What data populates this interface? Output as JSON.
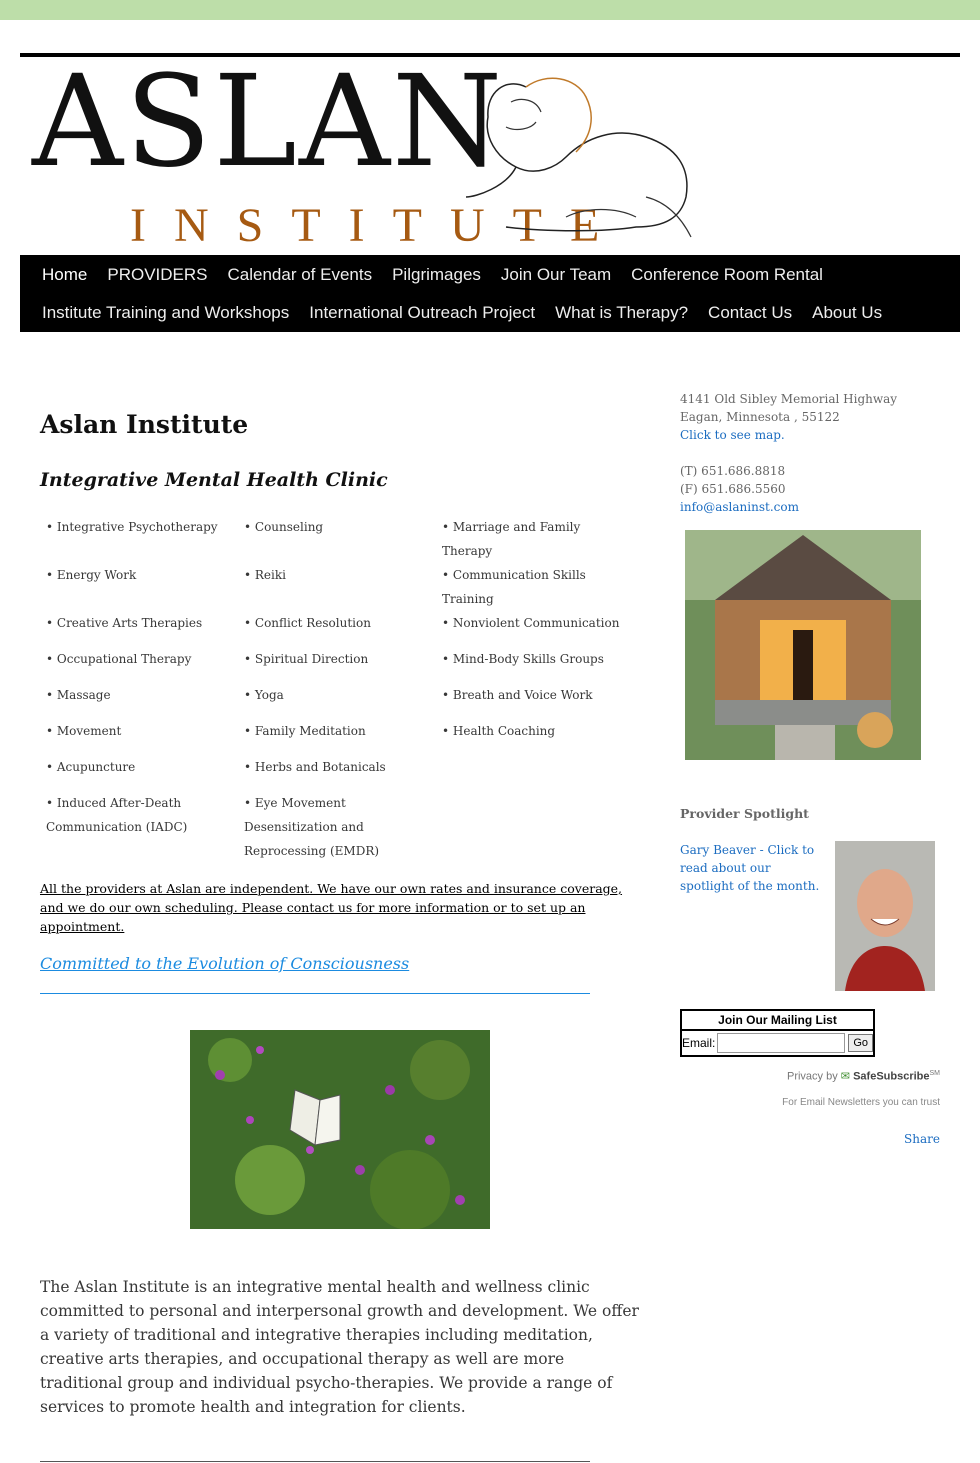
{
  "logo": {
    "aslan": "ASLAN",
    "institute": "INSTITUTE"
  },
  "nav": {
    "row1": [
      "Home",
      "PROVIDERS",
      "Calendar of Events",
      "Pilgrimages",
      "Join Our Team",
      "Conference Room Rental"
    ],
    "row2": [
      "Institute Training and Workshops",
      "International Outreach Project",
      "What is Therapy?",
      "Contact Us",
      "About Us"
    ]
  },
  "main": {
    "title": "Aslan Institute",
    "subtitle": "Integrative Mental Health Clinic",
    "services": [
      "• Integrative Psychotherapy",
      "• Counseling",
      "• Marriage and Family Therapy",
      "• Energy Work",
      "• Reiki",
      "• Communication Skills Training",
      "• Creative Arts Therapies",
      "• Conflict Resolution",
      "• Nonviolent Communication",
      "• Occupational Therapy",
      "• Spiritual Direction",
      "• Mind-Body Skills Groups",
      "• Massage",
      "• Yoga",
      "• Breath and Voice Work",
      "• Movement",
      "• Family Meditation",
      "• Health Coaching",
      "• Acupuncture",
      "• Herbs and Botanicals",
      "",
      "• Induced After-Death Communication (IADC)",
      "• Eye Movement Desensitization and Reprocessing (EMDR)",
      ""
    ],
    "disclaimer": "All the providers at Aslan are independent. We have our own rates and insurance coverage, and we do our own scheduling. Please contact us for more information or to set up an appointment.",
    "motto": "Committed to the Evolution of Consciousness",
    "intro": "The Aslan Institute is an integrative mental health and wellness clinic committed to personal and interpersonal growth and development. We offer a variety of traditional and integrative therapies including meditation, creative arts therapies, and occupational therapy as well are more traditional group and individual psycho-therapies. We provide a range of services to promote health and integration for clients."
  },
  "sidebar": {
    "address1": "4141 Old Sibley Memorial Highway",
    "address2": "Eagan, Minnesota , 55122",
    "map_link": "Click to see map.",
    "phone": "(T) 651.686.8818",
    "fax": "(F) 651.686.5560",
    "email": "info@aslaninst.com",
    "spotlight_title": "Provider Spotlight",
    "spotlight_link": "Gary Beaver - Click to read about our spotlight of the month.",
    "mailing_title": "Join Our Mailing List",
    "email_label": "Email:",
    "go": "Go",
    "privacy_by": "Privacy by",
    "safesubscribe": "SafeSubscribe",
    "sm": "SM",
    "trust": "For Email Newsletters you can trust",
    "share": "Share"
  },
  "colors": {
    "topbar": "#bddea9",
    "link": "#1b6cc0",
    "nav_bg": "#000000",
    "logo_gold": "#a65a12"
  }
}
